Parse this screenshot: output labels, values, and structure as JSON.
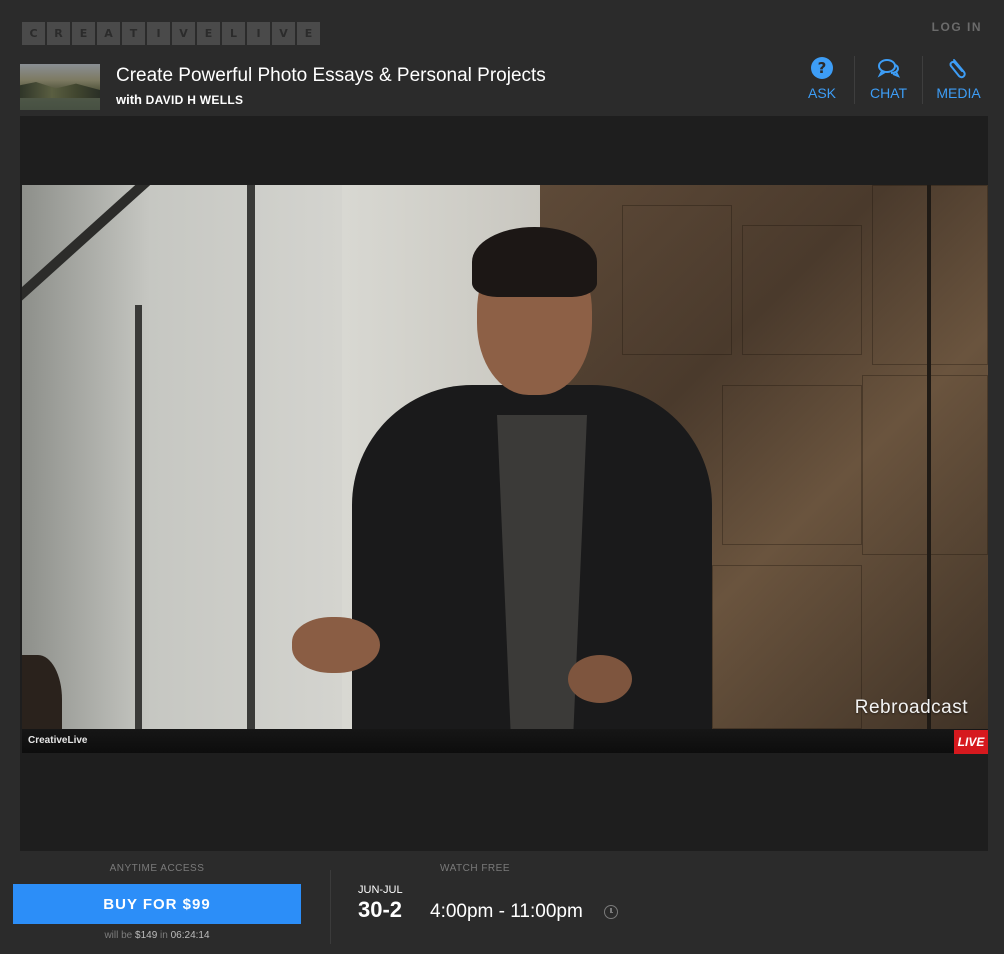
{
  "header": {
    "logo_letters": [
      "C",
      "R",
      "E",
      "A",
      "T",
      "I",
      "V",
      "E",
      "L",
      "I",
      "V",
      "E"
    ],
    "login_label": "LOG IN"
  },
  "course": {
    "title": "Create Powerful Photo Essays & Personal Projects",
    "with_prefix": "with",
    "instructor": "DAVID H WELLS"
  },
  "tools": [
    {
      "label": "ASK",
      "icon": "question-circle-icon"
    },
    {
      "label": "CHAT",
      "icon": "chat-bubbles-icon"
    },
    {
      "label": "MEDIA",
      "icon": "paperclip-icon"
    }
  ],
  "player": {
    "overlay_text": "Rebroadcast",
    "brand": "CreativeLive",
    "live_badge": "LIVE"
  },
  "purchase": {
    "section_label": "ANYTIME ACCESS",
    "buy_label": "BUY FOR $99",
    "note_prefix": "will be",
    "future_price": "$149",
    "note_mid": "in",
    "countdown": "06:24:14"
  },
  "schedule": {
    "section_label": "WATCH FREE",
    "months": "JUN-JUL",
    "days": "30-2",
    "time_range": "4:00pm - 11:00pm"
  },
  "colors": {
    "accent": "#2c8ef8",
    "tool_blue": "#3d9df6",
    "live_red": "#d6191e",
    "background": "#2b2b2b"
  }
}
